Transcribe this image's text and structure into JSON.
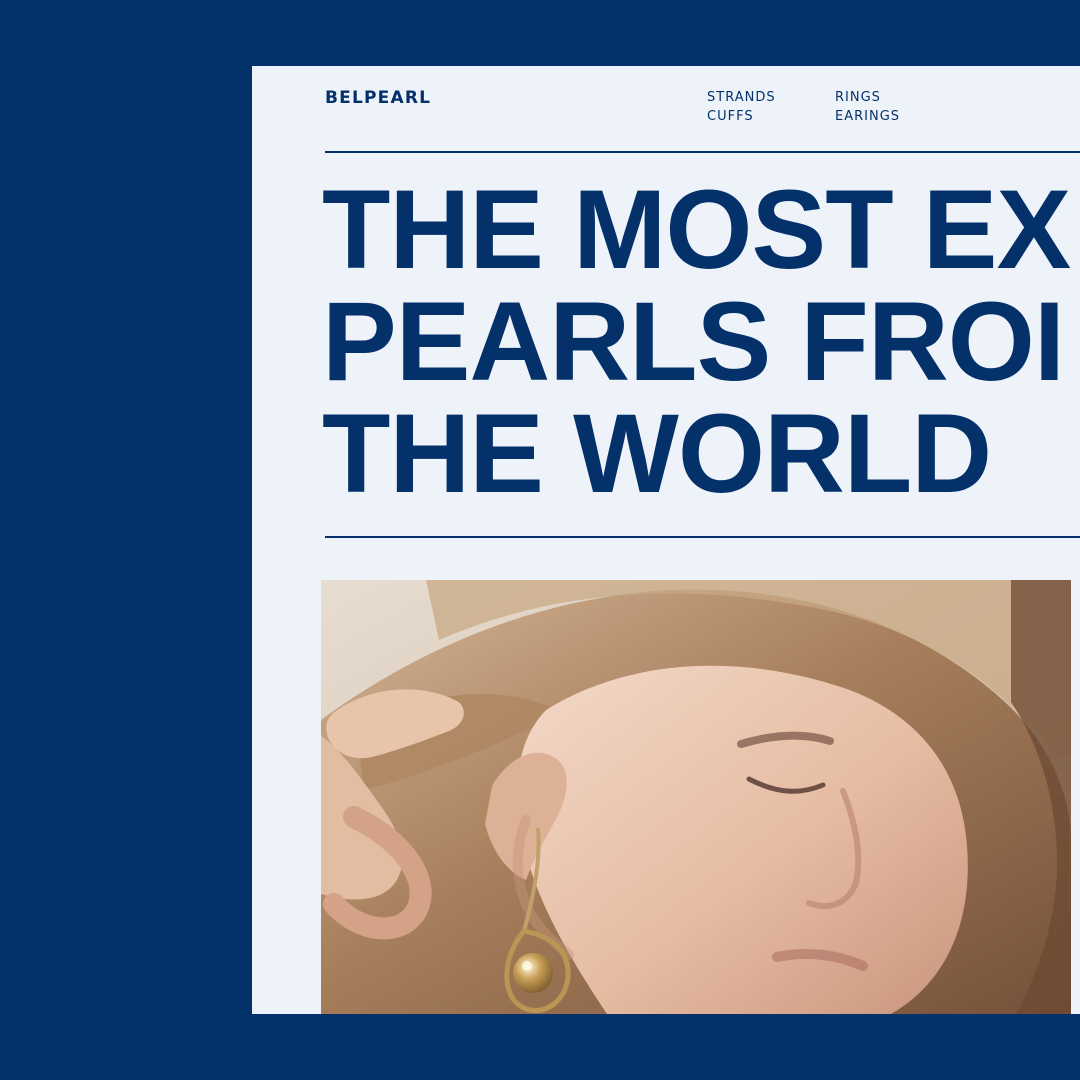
{
  "brand": {
    "name": "BELPEARL"
  },
  "nav": {
    "items": [
      {
        "label": "STRANDS"
      },
      {
        "label": "CUFFS"
      },
      {
        "label": "RINGS"
      },
      {
        "label": "EARINGS"
      }
    ]
  },
  "hero": {
    "lines": [
      "THE MOST EX",
      "PEARLS FROI",
      "THE WORLD"
    ]
  },
  "colors": {
    "brand_navy": "#04316A",
    "page_background": "#EEF3F9"
  },
  "media": {
    "image": {
      "icon": "hero-photo-earring"
    }
  }
}
